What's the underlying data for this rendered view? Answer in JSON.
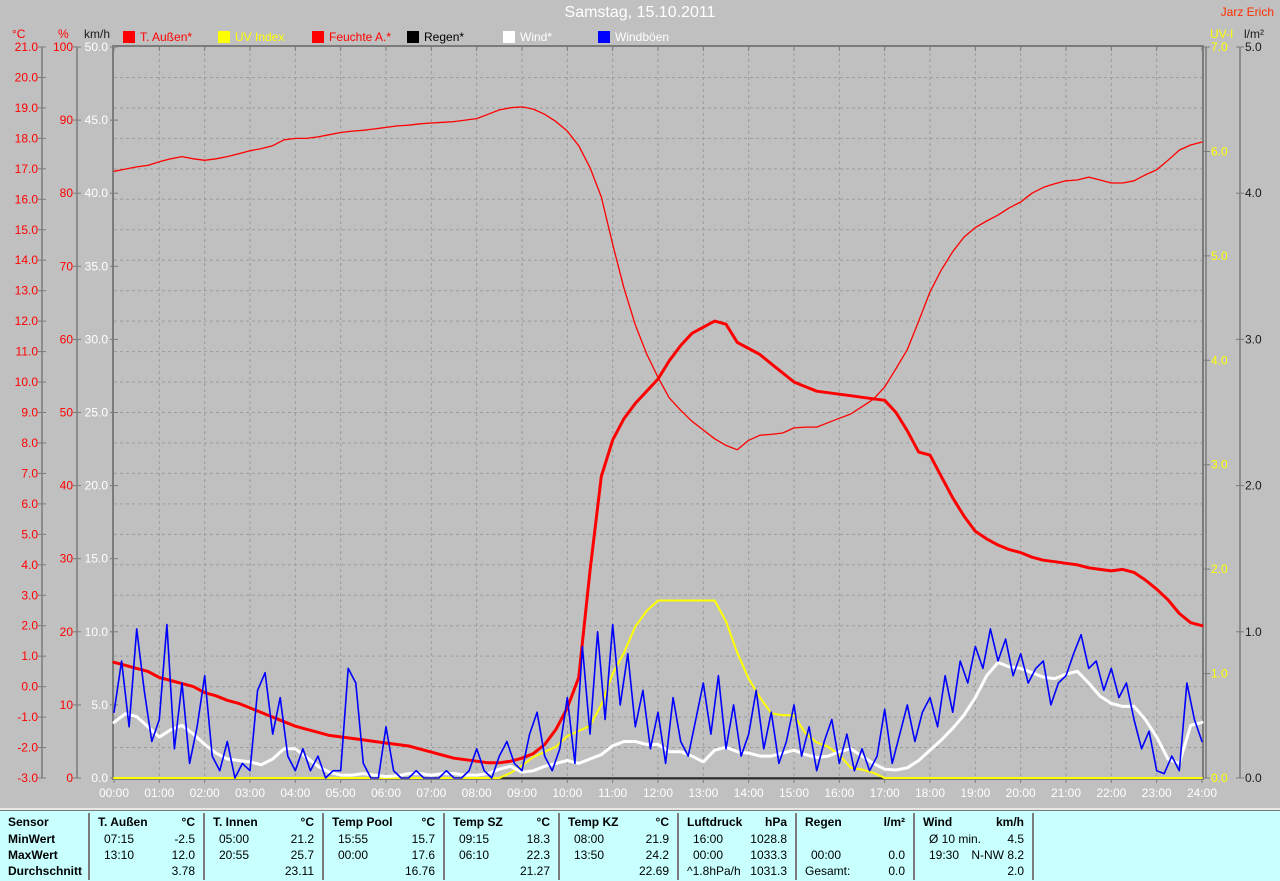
{
  "header": {
    "title": "Samstag, 15.10.2011",
    "watermark": "Jarz Erich"
  },
  "legend": [
    {
      "label": "T. Außen*",
      "swatch": "#ff0000",
      "text_color": "#ff0000"
    },
    {
      "label": "UV Index",
      "swatch": "#ffff00",
      "text_color": "#ffff00"
    },
    {
      "label": "Feuchte A.*",
      "swatch": "#ff0000",
      "text_color": "#ff0000"
    },
    {
      "label": "Regen*",
      "swatch": "#000000",
      "text_color": "#000000"
    },
    {
      "label": "Wind*",
      "swatch": "#ffffff",
      "text_color": "#ffffff"
    },
    {
      "label": "Windböen",
      "swatch": "#0000ff",
      "text_color": "#ffffff"
    }
  ],
  "axes": {
    "celsius": {
      "header": "°C",
      "color": "#ff0000",
      "labels": [
        "21.0",
        "20.0",
        "19.0",
        "18.0",
        "17.0",
        "16.0",
        "15.0",
        "14.0",
        "13.0",
        "12.0",
        "11.0",
        "10.0",
        "9.0",
        "8.0",
        "7.0",
        "6.0",
        "5.0",
        "4.0",
        "3.0",
        "2.0",
        "1.0",
        "0.0",
        "-1.0",
        "-2.0",
        "-3.0"
      ]
    },
    "percent": {
      "header": "%",
      "color": "#ff0000",
      "labels": [
        "100",
        "90",
        "80",
        "70",
        "60",
        "50",
        "40",
        "30",
        "20",
        "10",
        "0"
      ]
    },
    "kmh": {
      "header": "km/h",
      "header_color": "#1a1a1a",
      "color": "#ffffff",
      "labels": [
        "50.0",
        "45.0",
        "40.0",
        "35.0",
        "30.0",
        "25.0",
        "20.0",
        "15.0",
        "10.0",
        "5.0",
        "0.0"
      ]
    },
    "uv": {
      "header": "UV-I",
      "color": "#ffff00",
      "labels": [
        "7.0",
        "6.0",
        "5.0",
        "4.0",
        "3.0",
        "2.0",
        "1.0",
        "0.0"
      ]
    },
    "lm2": {
      "header": "l/m²",
      "color": "#1a1a1a",
      "labels": [
        "5.0",
        "4.0",
        "3.0",
        "2.0",
        "1.0",
        "0.0"
      ]
    },
    "time": {
      "color": "#ffffff",
      "labels": [
        "00:00",
        "01:00",
        "02:00",
        "03:00",
        "04:00",
        "05:00",
        "06:00",
        "07:00",
        "08:00",
        "09:00",
        "10:00",
        "11:00",
        "12:00",
        "13:00",
        "14:00",
        "15:00",
        "16:00",
        "17:00",
        "18:00",
        "19:00",
        "20:00",
        "21:00",
        "22:00",
        "23:00",
        "24:00"
      ]
    }
  },
  "chart_data": {
    "type": "line",
    "x_range_hours": [
      0,
      24
    ],
    "grid": {
      "h_step_celsius": 1.0,
      "v_step_hours": 1
    },
    "axes": {
      "celsius": {
        "min": -3,
        "max": 21
      },
      "percent": {
        "min": 0,
        "max": 100
      },
      "kmh": {
        "min": 0,
        "max": 50
      },
      "uv": {
        "min": 0,
        "max": 7
      },
      "lm2": {
        "min": 0,
        "max": 5
      }
    },
    "series": [
      {
        "name": "Regen",
        "axis": "lm2",
        "color": "#000000",
        "width": 1.2,
        "step_min": 1440,
        "values": [
          0,
          0
        ]
      },
      {
        "name": "Feuchte A.",
        "axis": "percent",
        "color": "#ff0000",
        "width": 1.3,
        "step_min": 15,
        "values": [
          83.0,
          83.3,
          83.6,
          83.8,
          84.3,
          84.7,
          85.0,
          84.7,
          84.5,
          84.7,
          85.0,
          85.4,
          85.8,
          86.1,
          86.5,
          87.3,
          87.5,
          87.5,
          87.7,
          88.0,
          88.3,
          88.5,
          88.6,
          88.8,
          89.0,
          89.2,
          89.3,
          89.5,
          89.6,
          89.7,
          89.8,
          90.0,
          90.2,
          90.8,
          91.4,
          91.7,
          91.8,
          91.5,
          90.8,
          89.8,
          88.5,
          86.5,
          83.5,
          79.5,
          73.0,
          67.0,
          62.0,
          58.0,
          54.8,
          52.0,
          50.3,
          48.8,
          47.6,
          46.4,
          45.5,
          44.9,
          46.2,
          46.9,
          47.0,
          47.2,
          47.9,
          48.0,
          48.0,
          48.6,
          49.2,
          49.8,
          50.8,
          51.8,
          53.5,
          56.0,
          58.6,
          62.5,
          66.5,
          69.5,
          72.0,
          74.0,
          75.3,
          76.2,
          77.0,
          78.0,
          78.8,
          80.0,
          80.8,
          81.3,
          81.7,
          81.8,
          82.2,
          81.8,
          81.4,
          81.4,
          81.7,
          82.5,
          83.2,
          84.5,
          85.9,
          86.6,
          87.0
        ]
      },
      {
        "name": "T. Außen",
        "axis": "celsius",
        "color": "#ff0000",
        "width": 3,
        "step_min": 15,
        "values": [
          0.8,
          0.7,
          0.6,
          0.5,
          0.3,
          0.2,
          0.1,
          0.0,
          -0.2,
          -0.3,
          -0.45,
          -0.55,
          -0.7,
          -0.85,
          -1.0,
          -1.15,
          -1.3,
          -1.4,
          -1.5,
          -1.6,
          -1.65,
          -1.7,
          -1.75,
          -1.8,
          -1.85,
          -1.9,
          -1.95,
          -2.05,
          -2.15,
          -2.25,
          -2.35,
          -2.4,
          -2.45,
          -2.5,
          -2.5,
          -2.45,
          -2.35,
          -2.2,
          -1.9,
          -1.4,
          -0.7,
          0.3,
          3.8,
          6.9,
          8.1,
          8.8,
          9.3,
          9.7,
          10.1,
          10.7,
          11.2,
          11.6,
          11.8,
          12.0,
          11.9,
          11.3,
          11.1,
          10.9,
          10.6,
          10.3,
          10.0,
          9.85,
          9.7,
          9.65,
          9.6,
          9.55,
          9.5,
          9.45,
          9.4,
          9.0,
          8.4,
          7.7,
          7.6,
          6.9,
          6.2,
          5.6,
          5.1,
          4.85,
          4.65,
          4.5,
          4.4,
          4.25,
          4.15,
          4.1,
          4.05,
          4.0,
          3.9,
          3.85,
          3.8,
          3.85,
          3.75,
          3.5,
          3.2,
          2.85,
          2.4,
          2.1,
          2.0
        ]
      },
      {
        "name": "UV Index",
        "axis": "uv",
        "color": "#ffff00",
        "width": 2,
        "step_min": 15,
        "stepped": true,
        "values": [
          0,
          0,
          0,
          0,
          0,
          0,
          0,
          0,
          0,
          0,
          0,
          0,
          0,
          0,
          0,
          0,
          0,
          0,
          0,
          0,
          0,
          0,
          0,
          0,
          0,
          0,
          0,
          0,
          0,
          0,
          0,
          0,
          0,
          0,
          0,
          0.05,
          0.12,
          0.2,
          0.25,
          0.3,
          0.4,
          0.45,
          0.5,
          0.7,
          1.0,
          1.2,
          1.45,
          1.6,
          1.7,
          1.7,
          1.7,
          1.7,
          1.7,
          1.7,
          1.5,
          1.2,
          0.95,
          0.77,
          0.62,
          0.6,
          0.6,
          0.43,
          0.34,
          0.3,
          0.22,
          0.1,
          0.08,
          0.05,
          0,
          0,
          0,
          0,
          0,
          0,
          0,
          0,
          0,
          0,
          0,
          0,
          0,
          0,
          0,
          0,
          0,
          0,
          0,
          0,
          0,
          0,
          0,
          0,
          0,
          0,
          0,
          0,
          0
        ]
      },
      {
        "name": "Wind",
        "axis": "kmh",
        "color": "#ffffff",
        "width": 3,
        "step_min": 15,
        "values": [
          3.8,
          4.4,
          4.2,
          3.5,
          2.8,
          3.3,
          3.6,
          3.0,
          2.3,
          1.7,
          1.3,
          1.2,
          1.1,
          0.9,
          1.3,
          2.0,
          2.0,
          1.4,
          0.8,
          0.4,
          0.2,
          0.2,
          0.3,
          0.2,
          0.1,
          0.15,
          0.3,
          0.3,
          0.2,
          0.3,
          0.3,
          0.2,
          0.2,
          0.3,
          0.6,
          0.8,
          0.4,
          0.5,
          0.8,
          1.0,
          1.2,
          1.0,
          1.3,
          1.6,
          2.2,
          2.5,
          2.5,
          2.3,
          2.3,
          1.8,
          1.8,
          1.5,
          1.1,
          1.9,
          2.1,
          1.8,
          1.7,
          1.5,
          1.5,
          1.7,
          1.9,
          1.6,
          1.4,
          1.5,
          1.8,
          2.0,
          1.5,
          1.0,
          0.6,
          0.55,
          0.7,
          1.2,
          1.9,
          2.6,
          3.4,
          4.3,
          5.5,
          7.0,
          7.9,
          7.6,
          7.5,
          7.2,
          6.9,
          6.8,
          7.1,
          7.3,
          6.5,
          5.6,
          5.1,
          4.9,
          4.9,
          4.0,
          2.8,
          1.3,
          1.0,
          3.6,
          3.8
        ]
      },
      {
        "name": "Windböen",
        "axis": "kmh",
        "color": "#0000ff",
        "width": 1.6,
        "step_min": 10,
        "values": [
          4.5,
          8.0,
          3.5,
          10.2,
          6.0,
          2.5,
          4.0,
          10.5,
          2.0,
          6.5,
          1.0,
          3.5,
          7.0,
          1.5,
          0.5,
          2.5,
          0.0,
          1.0,
          0.5,
          6.0,
          7.2,
          3.0,
          5.5,
          1.5,
          0.5,
          2.0,
          0.5,
          1.5,
          0.0,
          0.5,
          0.5,
          7.5,
          6.5,
          1.0,
          0.0,
          0.0,
          3.5,
          0.5,
          0.0,
          0.0,
          0.5,
          0.0,
          0.0,
          0.0,
          0.5,
          0.0,
          0.0,
          0.5,
          2.0,
          0.5,
          0.0,
          1.5,
          2.5,
          1.0,
          0.5,
          3.0,
          4.5,
          1.5,
          0.5,
          2.0,
          5.5,
          1.0,
          9.0,
          3.0,
          10.0,
          4.0,
          10.5,
          5.0,
          8.5,
          3.5,
          6.0,
          2.0,
          4.5,
          1.0,
          5.5,
          2.5,
          1.5,
          4.0,
          6.5,
          3.0,
          7.0,
          2.0,
          5.0,
          1.5,
          3.0,
          6.0,
          2.0,
          4.5,
          1.0,
          2.5,
          5.0,
          1.5,
          3.5,
          0.5,
          2.5,
          4.0,
          1.0,
          3.0,
          0.5,
          2.0,
          0.5,
          1.5,
          4.7,
          1.0,
          3.0,
          5.0,
          2.5,
          4.5,
          5.5,
          3.5,
          7.0,
          4.5,
          8.0,
          6.5,
          9.0,
          7.5,
          10.2,
          8.0,
          9.5,
          7.0,
          8.5,
          6.5,
          7.5,
          8.0,
          5.0,
          6.5,
          7.0,
          8.5,
          9.8,
          7.5,
          8.0,
          6.0,
          7.5,
          5.5,
          6.5,
          4.0,
          2.0,
          3.2,
          0.5,
          0.3,
          1.5,
          0.5,
          6.5,
          4.0,
          2.5
        ]
      }
    ]
  },
  "stats_table": {
    "row_labels": [
      "Sensor",
      "MinWert",
      "MaxWert",
      "Durchschnitt"
    ],
    "columns": [
      {
        "name": "T. Außen",
        "unit": "°C",
        "min_time": "07:15",
        "min_value": "-2.5",
        "max_time": "13:10",
        "max_value": "12.0",
        "avg_note": "",
        "avg_value": "3.78"
      },
      {
        "name": "T. Innen",
        "unit": "°C",
        "min_time": "05:00",
        "min_value": "21.2",
        "max_time": "20:55",
        "max_value": "25.7",
        "avg_note": "",
        "avg_value": "23.11"
      },
      {
        "name": "Temp Pool",
        "unit": "°C",
        "min_time": "15:55",
        "min_value": "15.7",
        "max_time": "00:00",
        "max_value": "17.6",
        "avg_note": "",
        "avg_value": "16.76"
      },
      {
        "name": "Temp SZ",
        "unit": "°C",
        "min_time": "09:15",
        "min_value": "18.3",
        "max_time": "06:10",
        "max_value": "22.3",
        "avg_note": "",
        "avg_value": "21.27"
      },
      {
        "name": "Temp KZ",
        "unit": "°C",
        "min_time": "08:00",
        "min_value": "21.9",
        "max_time": "13:50",
        "max_value": "24.2",
        "avg_note": "",
        "avg_value": "22.69"
      },
      {
        "name": "Luftdruck",
        "unit": "hPa",
        "min_time": "16:00",
        "min_value": "1028.8",
        "max_time": "00:00",
        "max_value": "1033.3",
        "avg_note": "^1.8hPa/h",
        "avg_value": "1031.3"
      },
      {
        "name": "Regen",
        "unit": "l/m²",
        "min_time": "",
        "min_value": "",
        "max_time": "00:00",
        "max_value": "0.0",
        "avg_note": "Gesamt:",
        "avg_value": "0.0"
      },
      {
        "name": "Wind",
        "unit": "km/h",
        "min_time": "Ø 10 min.",
        "min_value": "4.5",
        "max_time": "19:30",
        "max_value": "N-NW 8.2",
        "avg_note": "",
        "avg_value": "2.0"
      }
    ]
  }
}
